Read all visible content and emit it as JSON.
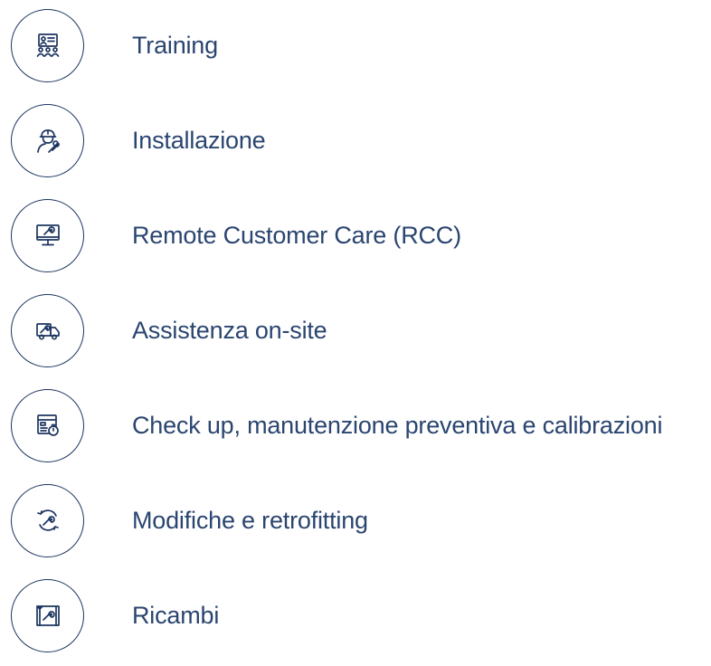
{
  "services": [
    {
      "label": "Training",
      "icon": "training-icon"
    },
    {
      "label": "Installazione",
      "icon": "technician-icon"
    },
    {
      "label": "Remote Customer Care (RCC)",
      "icon": "monitor-wrench-icon"
    },
    {
      "label": "Assistenza on-site",
      "icon": "service-truck-icon"
    },
    {
      "label": "Check up, manutenzione preventiva e calibrazioni",
      "icon": "checklist-stopwatch-icon"
    },
    {
      "label": "Modifiche e retrofitting",
      "icon": "rotating-wrench-icon"
    },
    {
      "label": "Ricambi",
      "icon": "spare-parts-icon"
    }
  ],
  "colors": {
    "icon_outline": "#1d3560",
    "label_text": "#2a4570",
    "background": "#ffffff"
  }
}
